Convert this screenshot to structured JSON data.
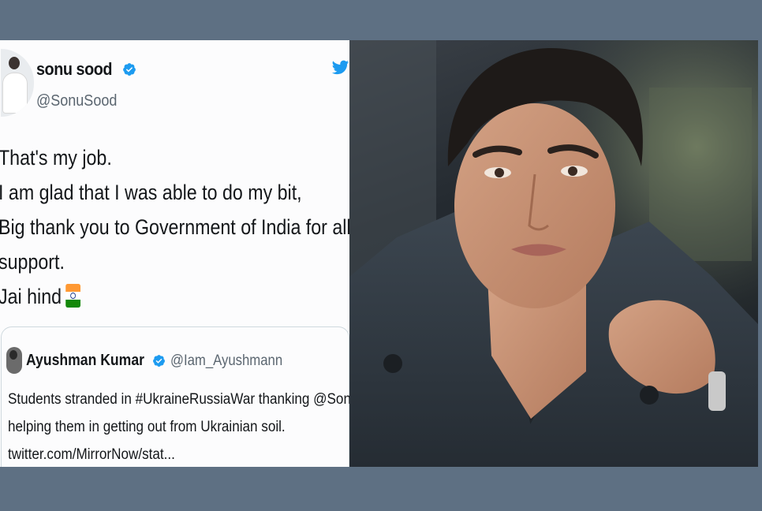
{
  "tweet": {
    "display_name": "sonu sood",
    "handle": "@SonuSood",
    "lines": [
      "That's my job.",
      "I am glad that I was able to do my bit,",
      "Big thank you to Government of India for all the",
      "support.",
      "Jai hind"
    ],
    "flag_icon": "india-flag-icon",
    "quoted": {
      "display_name": "Ayushman Kumar",
      "handle": "@Iam_Ayushmann",
      "lines": [
        "Students stranded in #UkraineRussiaWar thanking @SonuSood for",
        "helping them in getting out from Ukrainian soil.",
        "twitter.com/MirrorNow/stat..."
      ]
    }
  },
  "colors": {
    "background": "#5e7083",
    "twitter_blue": "#1d9bf0",
    "text": "#14171a",
    "muted": "#5b6670"
  },
  "photo": {
    "icon": "portrait-photo"
  }
}
